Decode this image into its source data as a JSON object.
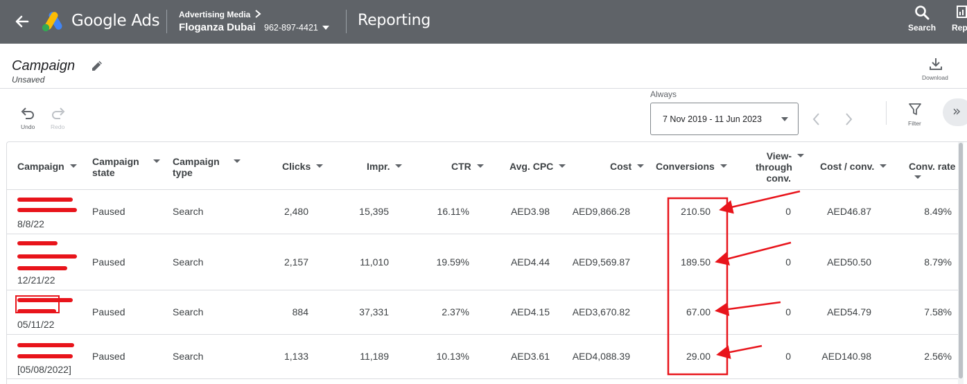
{
  "topbar": {
    "app_name": "Google Ads",
    "account_parent": "Advertising Media",
    "account_name": "Floganza Dubai",
    "account_id": "962-897-4421",
    "section": "Reporting",
    "search_label": "Search",
    "reports_label": "Rep"
  },
  "report": {
    "title": "Campaign",
    "status": "Unsaved",
    "download_label": "Download"
  },
  "toolbar": {
    "undo_label": "Undo",
    "redo_label": "Redo",
    "date_preset": "Always",
    "date_range": "7 Nov 2019 - 11 Jun 2023",
    "filter_label": "Filter"
  },
  "table": {
    "headers": {
      "campaign": "Campaign",
      "campaign_state_1": "Campaign",
      "campaign_state_2": "state",
      "campaign_type_1": "Campaign",
      "campaign_type_2": "type",
      "clicks": "Clicks",
      "impr": "Impr.",
      "ctr": "CTR",
      "avg_cpc": "Avg. CPC",
      "cost": "Cost",
      "conversions": "Conversions",
      "view_through_1": "View-",
      "view_through_2": "through",
      "view_through_3": "conv.",
      "cost_per_conv": "Cost / conv.",
      "conv_rate": "Conv. rate"
    },
    "rows": [
      {
        "name_suffix": "8/8/22",
        "state": "Paused",
        "type": "Search",
        "clicks": "2,480",
        "impr": "15,395",
        "ctr": "16.11%",
        "avg_cpc": "AED3.98",
        "cost": "AED9,866.28",
        "conversions": "210.50",
        "view_through": "0",
        "cost_per_conv": "AED46.87",
        "conv_rate": "8.49%"
      },
      {
        "name_suffix": "12/21/22",
        "state": "Paused",
        "type": "Search",
        "clicks": "2,157",
        "impr": "11,010",
        "ctr": "19.59%",
        "avg_cpc": "AED4.44",
        "cost": "AED9,569.87",
        "conversions": "189.50",
        "view_through": "0",
        "cost_per_conv": "AED50.50",
        "conv_rate": "8.79%"
      },
      {
        "name_suffix": "05/11/22",
        "state": "Paused",
        "type": "Search",
        "clicks": "884",
        "impr": "37,331",
        "ctr": "2.37%",
        "avg_cpc": "AED4.15",
        "cost": "AED3,670.82",
        "conversions": "67.00",
        "view_through": "0",
        "cost_per_conv": "AED54.79",
        "conv_rate": "7.58%"
      },
      {
        "name_suffix": "[05/08/2022]",
        "state": "Paused",
        "type": "Search",
        "clicks": "1,133",
        "impr": "11,189",
        "ctr": "10.13%",
        "avg_cpc": "AED3.61",
        "cost": "AED4,088.39",
        "conversions": "29.00",
        "view_through": "0",
        "cost_per_conv": "AED140.98",
        "conv_rate": "2.56%"
      }
    ]
  },
  "colors": {
    "topbar_bg": "#5f6368",
    "annotation_red": "#e8141b",
    "logo_blue": "#4285f4",
    "logo_yellow": "#fbbc04",
    "logo_green": "#34a853"
  }
}
